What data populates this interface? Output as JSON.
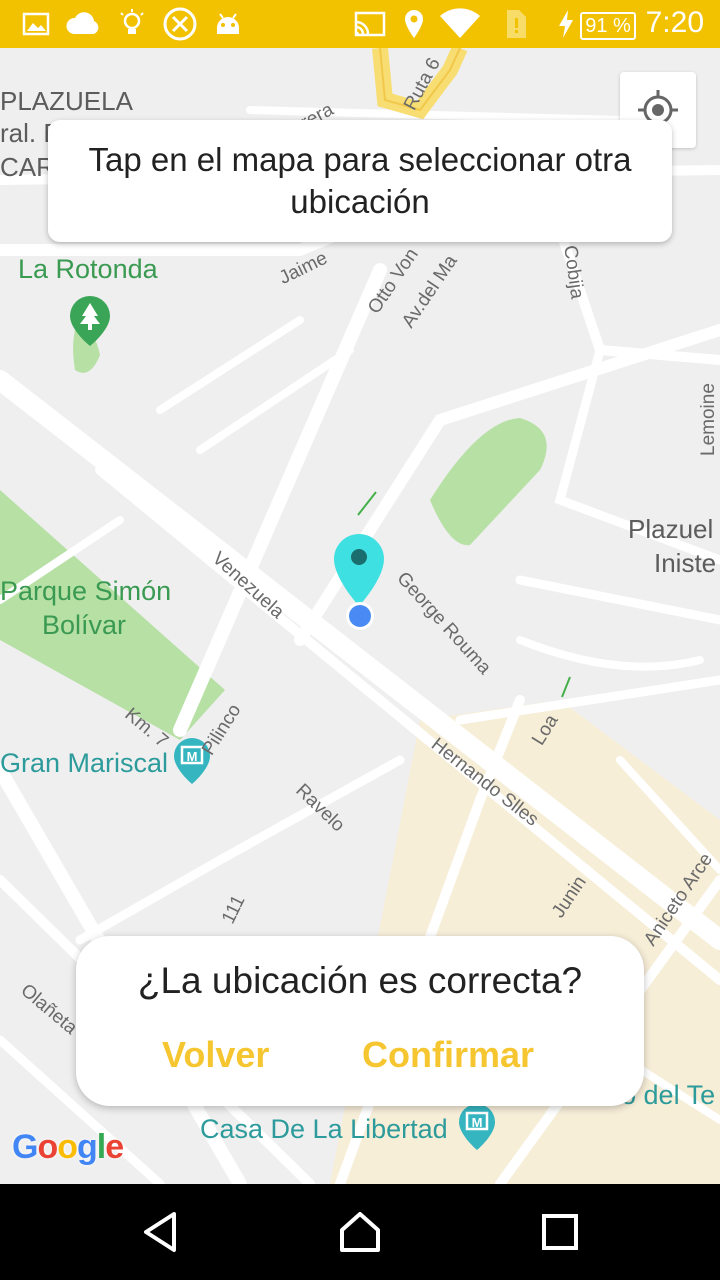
{
  "status_bar": {
    "time": "7:20",
    "battery": "91 %"
  },
  "map": {
    "labels": {
      "plazuela_top": "PLAZUELA",
      "plazuela_top_2": "ral. E",
      "plazuela_top_3": "CARI",
      "la_rotonda": "La Rotonda",
      "parque_1": "Parque Simón",
      "parque_2": "Bolívar",
      "gran_mariscal": "Gran Mariscal",
      "plazuela_right_1": "Plazuel",
      "plazuela_right_2": "Iniste",
      "casa_libertad": "Casa De La Libertad",
      "museo": "eo del Te"
    },
    "streets": {
      "ruta6": "Ruta 6",
      "cabrera": "brera",
      "jaime": "Jaime",
      "otto_von": "Otto Von",
      "av_del_ma": "Av.del Ma",
      "cobija": "Cobija",
      "lemoine": "Lemoine",
      "venezuela": "Venezuela",
      "george_rouma": "George Rouma",
      "loa": "Loa",
      "km7": "Km. 7",
      "pilinco": "Pilinco",
      "ravelo": "Ravelo",
      "hernando_siles": "Hernando Slles",
      "junin": "Junin",
      "aniceto_arce": "Aniceto Arce",
      "olaneta": "Olañeta",
      "n111": "111"
    },
    "selected_location": {
      "lat_hint": "pin"
    }
  },
  "tip": {
    "text": "Tap en el mapa para seleccionar otra ubicación"
  },
  "confirm": {
    "question": "¿La ubicación es correcta?",
    "back_label": "Volver",
    "confirm_label": "Confirmar"
  },
  "google_logo": "Google",
  "colors": {
    "status_bar": "#f2c100",
    "accent": "#f6c631",
    "pin": "#3ee0e0",
    "park": "#b7e0a5",
    "commercial": "#f7ecd2"
  }
}
